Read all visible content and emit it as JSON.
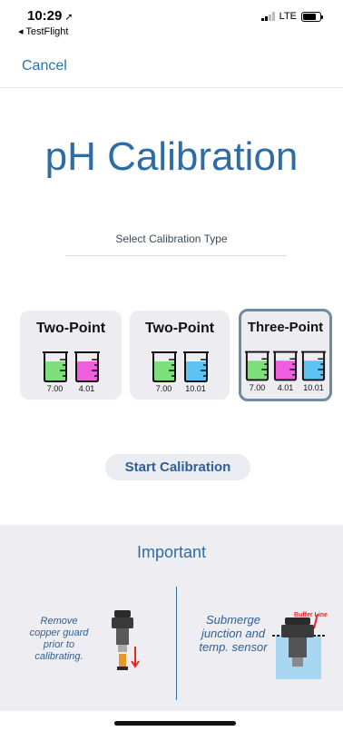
{
  "status_bar": {
    "time": "10:29",
    "location_glyph": "➚",
    "back_app": "◂ TestFlight",
    "network": "LTE"
  },
  "nav": {
    "cancel_label": "Cancel"
  },
  "page": {
    "title": "pH Calibration",
    "subtitle": "Select Calibration Type"
  },
  "options": [
    {
      "title": "Two-Point",
      "selected": false,
      "beakers": [
        {
          "label": "7.00",
          "color": "#7ee07a"
        },
        {
          "label": "4.01",
          "color": "#ee5fe0"
        }
      ]
    },
    {
      "title": "Two-Point",
      "selected": false,
      "beakers": [
        {
          "label": "7.00",
          "color": "#7ee07a"
        },
        {
          "label": "10.01",
          "color": "#5cc3f3"
        }
      ]
    },
    {
      "title": "Three-Point",
      "selected": true,
      "beakers": [
        {
          "label": "7.00",
          "color": "#7ee07a"
        },
        {
          "label": "4.01",
          "color": "#ee5fe0"
        },
        {
          "label": "10.01",
          "color": "#5cc3f3"
        }
      ]
    }
  ],
  "start_button_label": "Start Calibration",
  "important": {
    "title": "Important",
    "left_text": "Remove copper guard prior to calibrating.",
    "right_text": "Submerge junction and temp. sensor",
    "buffer_line_label": "Buffer Line"
  },
  "colors": {
    "accent": "#2e6da4",
    "selected_border": "#6e8aa4",
    "panel_bg": "#ededf2"
  }
}
